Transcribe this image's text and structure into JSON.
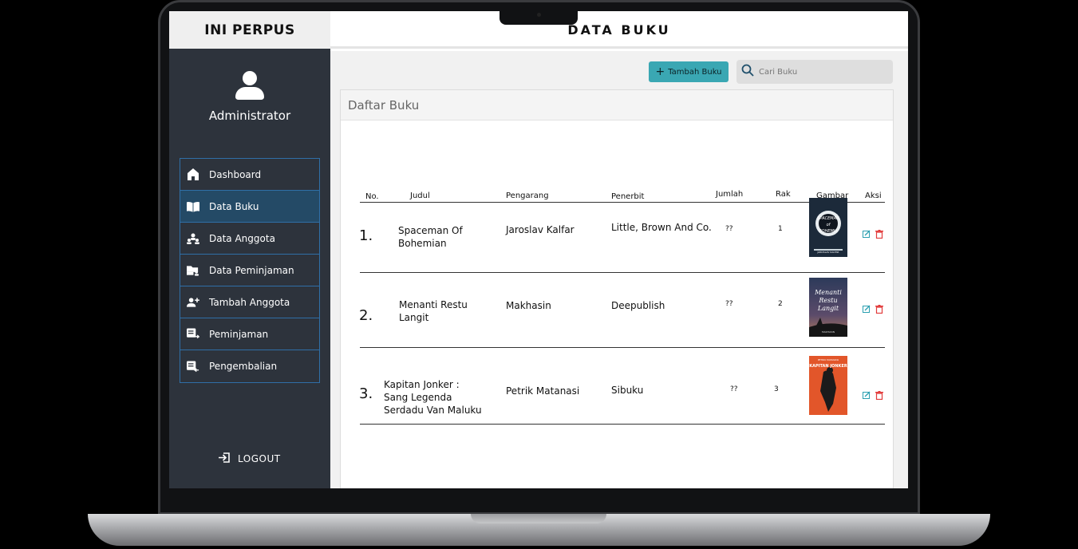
{
  "brand": "INI PERPUS",
  "page_title": "DATA BUKU",
  "user": {
    "name": "Administrator"
  },
  "menu": [
    {
      "label": "Dashboard",
      "icon": "home-icon"
    },
    {
      "label": "Data Buku",
      "icon": "book-open-icon",
      "active": true
    },
    {
      "label": "Data Anggota",
      "icon": "users-icon"
    },
    {
      "label": "Data Peminjaman",
      "icon": "folder-user-icon"
    },
    {
      "label": "Tambah Anggota",
      "icon": "user-plus-icon"
    },
    {
      "label": "Peminjaman",
      "icon": "list-arrow-icon"
    },
    {
      "label": "Pengembalian",
      "icon": "list-return-icon"
    }
  ],
  "logout_label": "LOGOUT",
  "toolbar": {
    "add_label": "Tambah Buku",
    "search_placeholder": "Cari Buku"
  },
  "card_title": "Daftar Buku",
  "table": {
    "headers": [
      "No.",
      "Judul",
      "Pengarang",
      "Penerbit",
      "Jumlah",
      "Rak",
      "Gambar",
      "Aksi"
    ],
    "rows": [
      {
        "no": "1.",
        "judul": "Spaceman Of Bohemian",
        "pengarang": "Jaroslav Kalfar",
        "penerbit": "Little, Brown And Co.",
        "jumlah": "??",
        "rak": "1",
        "cover_title": "SPACEMAN of BOHEMIA",
        "cover_author": "JAROSLAV KALFAR"
      },
      {
        "no": "2.",
        "judul": "Menanti Restu Langit",
        "pengarang": "Makhasin",
        "penerbit": "Deepublish",
        "jumlah": "??",
        "rak": "2",
        "cover_title": "Menanti Restu Langit",
        "cover_author": "MAKHASIN"
      },
      {
        "no": "3.",
        "judul": "Kapitan Jonker : Sang Legenda Serdadu Van Maluku",
        "pengarang": "Petrik Matanasi",
        "penerbit": "Sibuku",
        "jumlah": "??",
        "rak": "3",
        "cover_title": "KAPITAN JONKER",
        "cover_author": "PETRIK MATANASI"
      }
    ]
  },
  "colors": {
    "sidebar": "#2d333c",
    "accent": "#3aa7b3",
    "menu_border": "#2f6fa7",
    "menu_active": "#244a66",
    "edit": "#2a9fb0",
    "delete": "#e23b3b"
  }
}
